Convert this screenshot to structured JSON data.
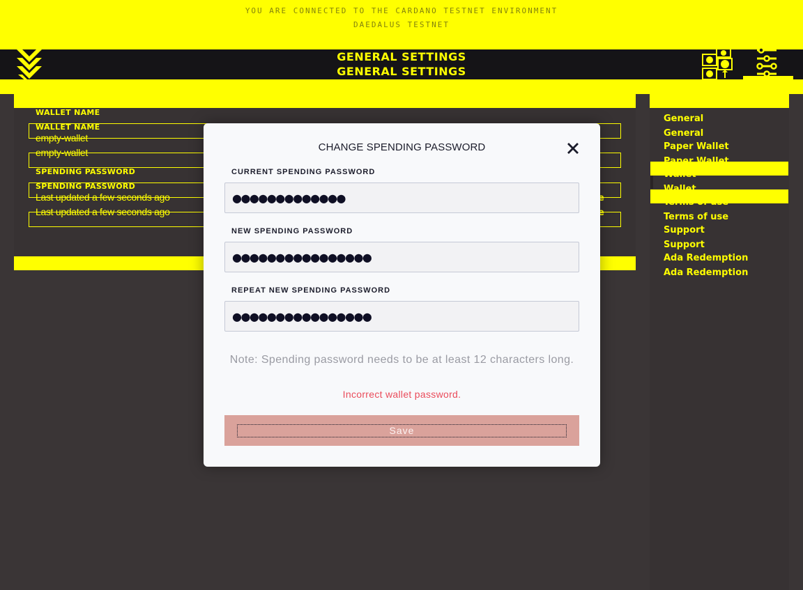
{
  "banner": {
    "line1": "YOU ARE CONNECTED TO THE CARDANO TESTNET ENVIRONMENT",
    "line2": "DAEDALUS TESTNET"
  },
  "header": {
    "title": "GENERAL SETTINGS",
    "title_duplicate": "GENERAL SETTINGS",
    "icons": [
      "daedalus-logo-icon",
      "wallet-icon",
      "settings-icon"
    ]
  },
  "content": {
    "wallet_name_label": "WALLET NAME",
    "wallet_name_label_duplicate": "WALLET NAME",
    "wallet_name_value": "empty-wallet",
    "wallet_name_value_duplicate": "empty-wallet",
    "spending_password_label": "SPENDING PASSWORD",
    "spending_password_label_duplicate": "SPENDING PASSWORD",
    "spending_password_value": "Last updated a few seconds ago",
    "spending_password_value_duplicate": "Last updated a few seconds ago",
    "change_link_fragment": "e"
  },
  "sidebar": {
    "items": [
      {
        "label": "General"
      },
      {
        "label": "General"
      },
      {
        "label": "Paper Wallet"
      },
      {
        "label": "Paper Wallet"
      },
      {
        "label": "Wallet"
      },
      {
        "label": "Wallet"
      },
      {
        "label": "Terms of use"
      },
      {
        "label": "Terms of use"
      },
      {
        "label": "Support"
      },
      {
        "label": "Support"
      },
      {
        "label": "Ada Redemption"
      },
      {
        "label": "Ada Redemption"
      }
    ],
    "active": "Wallet"
  },
  "modal": {
    "title": "CHANGE SPENDING PASSWORD",
    "close_icon": "close-icon",
    "fields": [
      {
        "label": "CURRENT SPENDING PASSWORD",
        "value": "●●●●●●●●●●●●●",
        "masked_length": 13
      },
      {
        "label": "NEW SPENDING PASSWORD",
        "value": "●●●●●●●●●●●●●●●●",
        "masked_length": 16
      },
      {
        "label": "REPEAT NEW SPENDING PASSWORD",
        "value": "●●●●●●●●●●●●●●●●",
        "masked_length": 16
      }
    ],
    "note": "Note: Spending password needs to be at least 12 characters long.",
    "error": "Incorrect wallet password.",
    "save_label": "Save"
  },
  "colors": {
    "highlight_yellow": "#ffff00",
    "topbar": "#151417",
    "background": "#3a3536",
    "modal_bg": "#f8f9fb",
    "error_red": "#ea4c5b",
    "save_button": "#daa29b"
  }
}
